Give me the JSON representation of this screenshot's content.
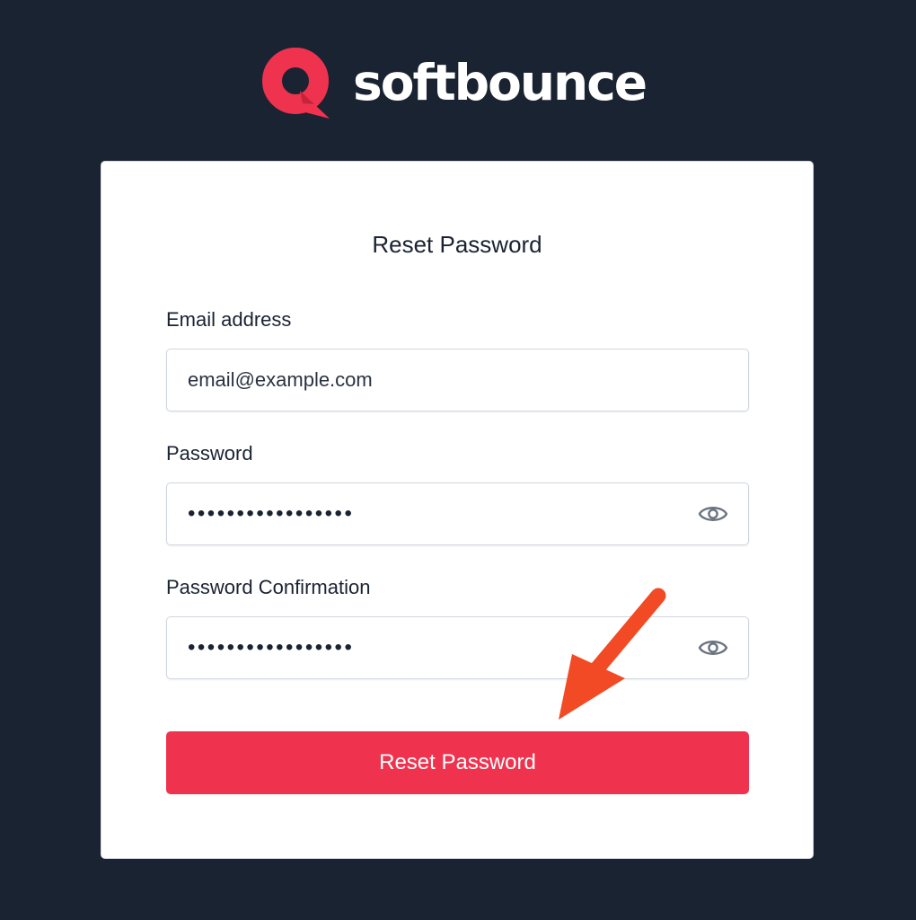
{
  "brand": {
    "name": "softbounce",
    "accent_color": "#ef334f"
  },
  "form": {
    "title": "Reset Password",
    "email": {
      "label": "Email address",
      "value": "email@example.com"
    },
    "password": {
      "label": "Password",
      "masked_value": "•••••••••••••••••",
      "toggle_icon": "eye-icon"
    },
    "password_confirmation": {
      "label": "Password Confirmation",
      "masked_value": "•••••••••••••••••",
      "toggle_icon": "eye-icon"
    },
    "submit_label": "Reset Password"
  },
  "annotation": {
    "icon": "arrow-pointer-icon",
    "color": "#f24a24"
  },
  "colors": {
    "background": "#1a2332",
    "card": "#ffffff",
    "button": "#ef334f"
  }
}
